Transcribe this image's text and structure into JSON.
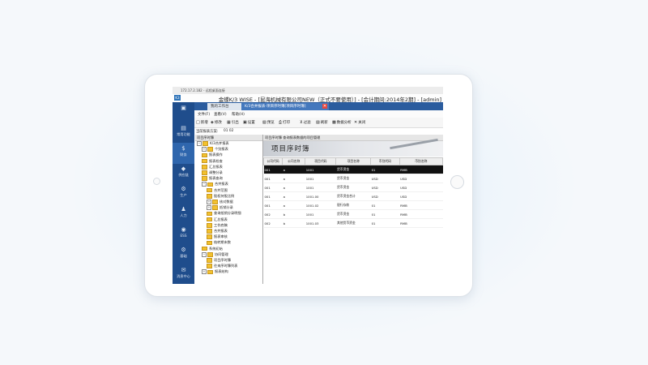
{
  "window": {
    "top_title": "172.17.2.182 - 远程桌面连接",
    "app_icon": "K3",
    "main_title": "金蝶K/3 WISE - [昆海机械有限公司NEW（正式不要使用）] - [会计期间:2014年2期] - [admin]"
  },
  "sidebar": {
    "items": [
      {
        "icon": "home-icon",
        "glyph": "▣",
        "label": ""
      },
      {
        "icon": "favorites-icon",
        "glyph": "▤",
        "label": "常用功能"
      },
      {
        "icon": "finance-icon",
        "glyph": "$",
        "label": "财务"
      },
      {
        "icon": "supply-chain-icon",
        "glyph": "◆",
        "label": "供应链"
      },
      {
        "icon": "production-icon",
        "glyph": "⚙",
        "label": "生产"
      },
      {
        "icon": "hr-icon",
        "glyph": "♟",
        "label": "人力"
      },
      {
        "icon": "ess-icon",
        "glyph": "◉",
        "label": "ESS"
      },
      {
        "icon": "base-icon",
        "glyph": "⚙",
        "label": "基础"
      },
      {
        "icon": "message-icon",
        "glyph": "✉",
        "label": "消息中心"
      }
    ]
  },
  "tabs": [
    {
      "label": "我的工作台"
    },
    {
      "label": "K/3合并报表-项目序时簿[项目序时簿]",
      "close_glyph": "✕"
    }
  ],
  "menubar": [
    "文件(F)",
    "查看(V)",
    "帮助(H)"
  ],
  "toolbar": [
    {
      "icon": "new-icon",
      "glyph": "□",
      "label": "新增"
    },
    {
      "icon": "modify-icon",
      "glyph": "◈",
      "label": "修改"
    },
    {
      "icon": "export-icon",
      "glyph": "▦",
      "label": "引出"
    },
    {
      "icon": "settings-icon",
      "glyph": "▣",
      "label": "设置"
    },
    {
      "icon": "preview-icon",
      "glyph": "▧",
      "label": "预览"
    },
    {
      "icon": "print-icon",
      "glyph": "⎙",
      "label": "打印"
    },
    {
      "icon": "filter-icon",
      "glyph": "⊻",
      "label": "过滤"
    },
    {
      "icon": "refresh-icon",
      "glyph": "▨",
      "label": "刷新"
    },
    {
      "icon": "data-analysis-icon",
      "glyph": "▩",
      "label": "数据分析"
    },
    {
      "icon": "close-icon",
      "glyph": "✕",
      "label": "关闭"
    }
  ],
  "scheme": {
    "label": "当前报表方案:",
    "value": "01 02"
  },
  "tree": {
    "header": "项目序时簿",
    "nodes": [
      {
        "label": "K/3合并报表",
        "pm": "−",
        "indent": 0
      },
      {
        "label": "个别报表",
        "pm": "+",
        "indent": 1
      },
      {
        "label": "报表操作",
        "pm": "",
        "indent": 1
      },
      {
        "label": "报表检查",
        "pm": "",
        "indent": 1
      },
      {
        "label": "汇总报表",
        "pm": "",
        "indent": 1
      },
      {
        "label": "调整分录",
        "pm": "",
        "indent": 1
      },
      {
        "label": "报表查询",
        "pm": "",
        "indent": 1
      },
      {
        "label": "合并报表",
        "pm": "−",
        "indent": 1
      },
      {
        "label": "合并范围",
        "pm": "",
        "indent": 2
      },
      {
        "label": "股权持股比例",
        "pm": "",
        "indent": 2
      },
      {
        "label": "核对数据",
        "pm": "+",
        "indent": 2
      },
      {
        "label": "抵销分录",
        "pm": "+",
        "indent": 2
      },
      {
        "label": "查询抵销分录明细",
        "pm": "",
        "indent": 2
      },
      {
        "label": "汇总报表",
        "pm": "",
        "indent": 2
      },
      {
        "label": "工作底稿",
        "pm": "",
        "indent": 2
      },
      {
        "label": "合并报表",
        "pm": "",
        "indent": 2
      },
      {
        "label": "报表审核",
        "pm": "",
        "indent": 2
      },
      {
        "label": "结转期末数",
        "pm": "",
        "indent": 2
      },
      {
        "label": "系统初始",
        "pm": "",
        "indent": 1
      },
      {
        "label": "协同管理",
        "pm": "−",
        "indent": 1
      },
      {
        "label": "项目序时簿",
        "pm": "",
        "indent": 2
      },
      {
        "label": "往来序时簿列表",
        "pm": "",
        "indent": 2
      },
      {
        "label": "报表结构",
        "pm": "+",
        "indent": 1
      }
    ]
  },
  "right": {
    "header": "项目序时簿 查询报表数据的项目管理",
    "banner_title": "项目序时簿",
    "columns": [
      "公司代码",
      "公司名称",
      "项目代码",
      "项目名称",
      "币别代码",
      "币别名称"
    ],
    "rows": [
      {
        "c": [
          "001",
          "a",
          "1001",
          "货币资金",
          "01",
          "RMB"
        ],
        "selected": true
      },
      {
        "c": [
          "001",
          "a",
          "1001",
          "货币资金",
          "USD",
          "USD"
        ],
        "selected": false
      },
      {
        "c": [
          "001",
          "a",
          "1001",
          "货币资金",
          "USD",
          "USD"
        ],
        "selected": false
      },
      {
        "c": [
          "001",
          "a",
          "1001.00",
          "货币资金合计",
          "USD",
          "USD"
        ],
        "selected": false
      },
      {
        "c": [
          "001",
          "a",
          "1001.02",
          "银行存款",
          "01",
          "RMB"
        ],
        "selected": false
      },
      {
        "c": [
          "002",
          "b",
          "1001",
          "货币资金",
          "01",
          "RMB"
        ],
        "selected": false
      },
      {
        "c": [
          "002",
          "b",
          "1001.03",
          "其他货币资金",
          "01",
          "RMB"
        ],
        "selected": false
      }
    ]
  }
}
